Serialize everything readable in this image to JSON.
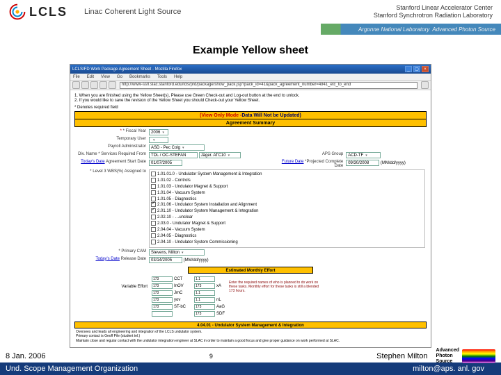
{
  "header": {
    "logo_text": "LCLS",
    "subtitle": "Linac Coherent Light Source",
    "right_line1": "Stanford Linear Accelerator Center",
    "right_line2": "Stanford Synchrotron Radiation Laboratory",
    "mini_band_lab": "Argonne National Laboratory",
    "mini_band_src": "Advanced Photon Source"
  },
  "title": "Example Yellow sheet",
  "browser": {
    "window_title": "LCLS/FD Work Package Agreement Sheet - Mozilla Firefox",
    "menu": [
      "File",
      "Edit",
      "View",
      "Go",
      "Bookmarks",
      "Tools",
      "Help"
    ],
    "address": "http://www-ssrl.slac.stanford.edu/lcls/prd/package/show_pack.jsp?pack_id=41&pack_agreement_number=4941_etc_to_end",
    "notice1": "1. When you are finished using the Yellow Sheet(s), Please use Green Check-out and Log-out button at the end to unlock.",
    "notice2": "2. If you would like to save the revision of the Yellow Sheet you should Check-out your Yellow Sheet.",
    "required_label": "* Denotes required field"
  },
  "banner": {
    "view_mode": "(View Only Mode - ",
    "will_not": "Data Will Not be Updated)",
    "summary": "Agreement Summary"
  },
  "form": {
    "fiscal_year_label": "* Fiscal Year",
    "fiscal_year": "2006",
    "temp_user_label": "Temporary User",
    "temp_user": "",
    "payroll_label": "Payroll Administrator",
    "payroll": "ASD - Pec Colg",
    "div_label": "Div. Name * Services Required From",
    "div_name": "TDL / OC-STEFAN",
    "div_sel": "Jäger. ATC10",
    "aps_group_label": "APS Group",
    "aps_group": "ACD-TF",
    "todays_date1": "Today's Date",
    "agree_start_label": "Agreement Start Date",
    "agree_start": "01/07/2005",
    "future_date": "Future Date",
    "complete_label": "*Projected Complete Date",
    "complete_date": "09/30/2008",
    "complete_fmt": "(MM/dd/yyyy)",
    "wbs_label": "* Level 3 WBS(%) Assigned to",
    "wbs_items": [
      {
        "on": false,
        "text": "1.01.01.0 - Undulator System Management & Integration"
      },
      {
        "on": false,
        "text": "1.01.02 - Controls"
      },
      {
        "on": false,
        "text": "1.01.03 - Undulator Magnet & Support"
      },
      {
        "on": false,
        "text": "1.01.04 - Vacuum System"
      },
      {
        "on": false,
        "text": "1.01.05 - Diagnostics"
      },
      {
        "on": true,
        "text": "2.01.06 - Undulator System Installation and Alignment"
      },
      {
        "on": true,
        "text": "2.01.10 - Undulator System Management & Integration"
      },
      {
        "on": false,
        "text": "2.02.10 - …unclear"
      },
      {
        "on": false,
        "text": "2.03.0 - Undulator Magnet & Support"
      },
      {
        "on": false,
        "text": "2.04.04 - Vacuum System"
      },
      {
        "on": false,
        "text": "2.04.05 - Diagnostics"
      },
      {
        "on": false,
        "text": "2.04.10 - Undulator System Commissioning"
      }
    ],
    "primary_cam_label": "* Primary CAM",
    "primary_cam": "Stevens, Milton",
    "release_label": "Release Date",
    "release_date": "03/14/2005",
    "release_fmt": "(MM/dd/yyyy)"
  },
  "estimates": {
    "title": "Estimated Monthly Effort",
    "var_label": "Variable Effort",
    "rows": [
      {
        "v": "173",
        "name": "CCT",
        "v2": "1.1"
      },
      {
        "v": "173",
        "name": "InOV",
        "v2": "173",
        "name2": "xA"
      },
      {
        "v": "173",
        "name": "JmC",
        "v2": "1.1"
      },
      {
        "v": "173",
        "name": "yov",
        "v2": "1.1",
        "name2": "nL"
      },
      {
        "v": "173",
        "name": "ST-bC",
        "v2": "173",
        "name2": "AaG"
      },
      {
        "v": "",
        "name": "",
        "v2": "173",
        "name2": "SDF"
      }
    ],
    "note": "Enter the required names of who is planned to do work on these tasks. Monthly effort for these tasks is still a blended 173 hours."
  },
  "task_section": {
    "title": "4.04.01 - Undulator System Management & Integration",
    "line1": "Oversees and leads all engineering and integration of the LCLS undulator system.",
    "line2": "Primary contact is Geoff Pile (student tel.)",
    "line3": "Maintain close and regular contact with the undulator integration engineer at SLAC in order to maintain a good focus and give proper guidance on work performed at SLAC."
  },
  "footer": {
    "date": "8 Jan. 2006",
    "page": "9",
    "author": "Stephen Milton",
    "aps_line1": "Advanced",
    "aps_line2": "Photon",
    "aps_line3": "Source",
    "org": "Und. Scope Management Organization",
    "email": "milton@aps. anl. gov"
  }
}
